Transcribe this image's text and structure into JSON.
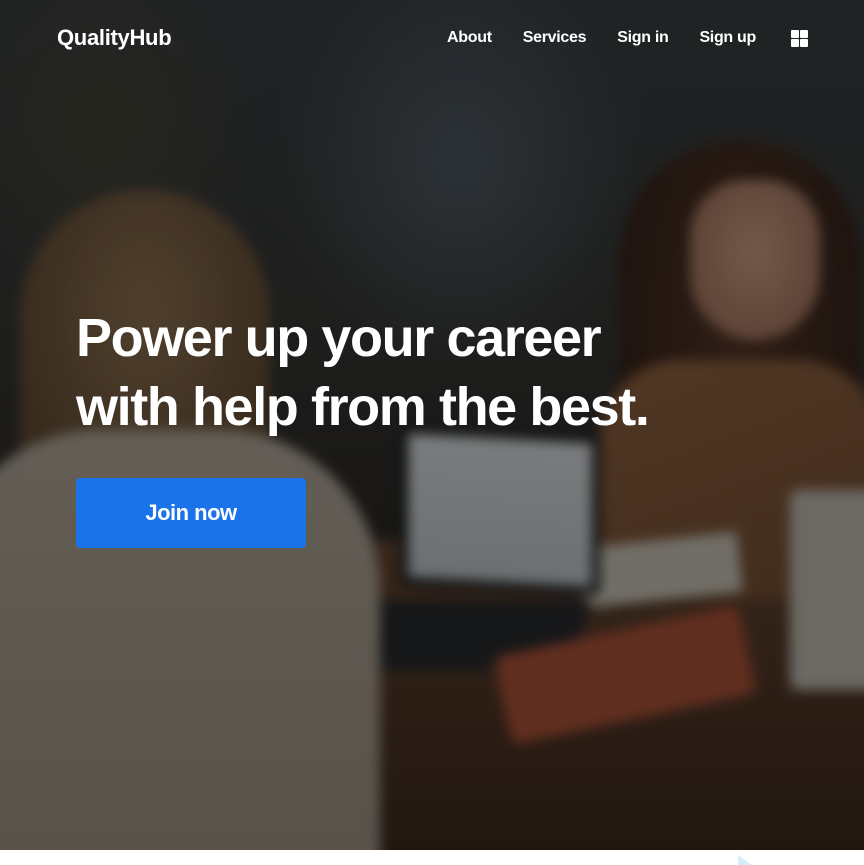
{
  "header": {
    "brand": "QualityHub",
    "nav": [
      {
        "label": "About"
      },
      {
        "label": "Services"
      },
      {
        "label": "Sign in"
      },
      {
        "label": "Sign up"
      }
    ],
    "menu_icon": "grid-icon"
  },
  "hero": {
    "headline_line1": "Power up your career",
    "headline_line2": "with help from the best.",
    "cta_label": "Join now",
    "background_image": "people-working-at-laptops-photo"
  },
  "colors": {
    "cta": "#1a73e8",
    "text": "#ffffff"
  }
}
